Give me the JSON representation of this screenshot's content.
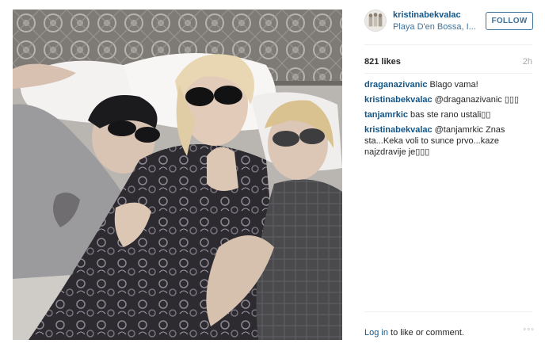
{
  "post": {
    "username": "kristinabekvalac",
    "location": "Playa D'en Bossa, I...",
    "follow_label": "FOLLOW",
    "likes": "821 likes",
    "time": "2h"
  },
  "comments": [
    {
      "user": "draganazivanic",
      "text": "Blago vama!"
    },
    {
      "user": "kristinabekvalac",
      "text": "@draganazivanic ▯▯▯"
    },
    {
      "user": "tanjamrkic",
      "text": "bas ste rano ustali▯▯"
    },
    {
      "user": "kristinabekvalac",
      "text": "@tanjamrkic Znas sta...Keka voli to sunce prvo...kaze najzdravije je▯▯▯"
    }
  ],
  "footer": {
    "login_link": "Log in",
    "login_rest": " to like or comment.",
    "more_label": "◦◦◦"
  },
  "icons": {
    "more": "more-options-icon"
  }
}
